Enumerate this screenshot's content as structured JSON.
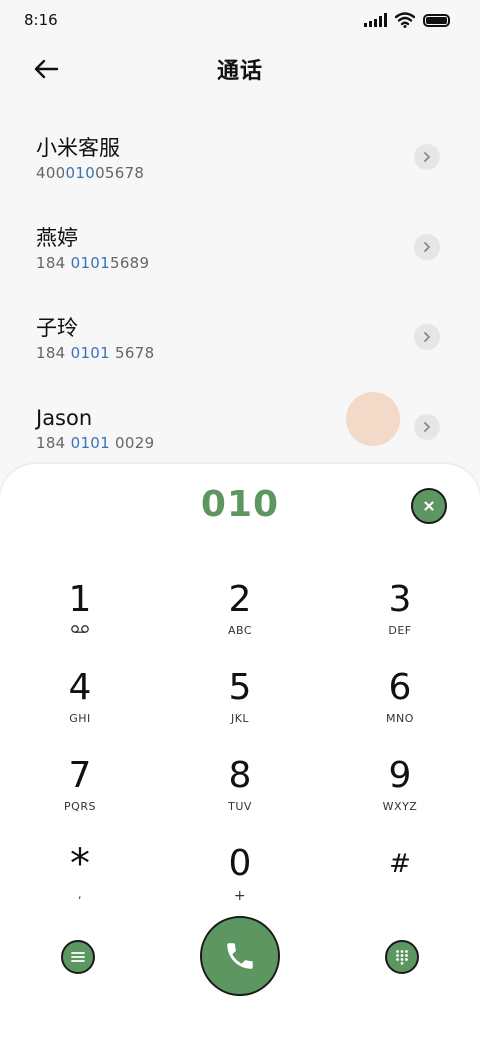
{
  "status_bar": {
    "time": "8:16"
  },
  "header": {
    "title": "通话"
  },
  "contacts": [
    {
      "name": "小米客服",
      "number_parts": [
        "400",
        "010",
        "05678"
      ]
    },
    {
      "name": "燕婷",
      "number_parts": [
        "184 ",
        "0101",
        "5689"
      ]
    },
    {
      "name": "子玲",
      "number_parts": [
        "184 ",
        "0101",
        " 5678"
      ]
    },
    {
      "name": "Jason",
      "number_parts": [
        "184 ",
        "0101",
        " 0029"
      ]
    }
  ],
  "dialpad": {
    "display": "010",
    "keys": [
      {
        "digit": "1",
        "letters": ""
      },
      {
        "digit": "2",
        "letters": "ABC"
      },
      {
        "digit": "3",
        "letters": "DEF"
      },
      {
        "digit": "4",
        "letters": "GHI"
      },
      {
        "digit": "5",
        "letters": "JKL"
      },
      {
        "digit": "6",
        "letters": "MNO"
      },
      {
        "digit": "7",
        "letters": "PQRS"
      },
      {
        "digit": "8",
        "letters": "TUV"
      },
      {
        "digit": "9",
        "letters": "WXYZ"
      },
      {
        "digit": "*",
        "letters": ","
      },
      {
        "digit": "0",
        "letters": "+"
      },
      {
        "digit": "#",
        "letters": ""
      }
    ]
  },
  "colors": {
    "accent_green": "#5d9660",
    "highlight_blue": "#3a72b8",
    "background": "#f7f7f7"
  },
  "icons": {
    "back": "arrow-left-icon",
    "chevron": "chevron-right-icon",
    "clear": "close-icon",
    "menu": "menu-icon",
    "call": "phone-icon",
    "keypad": "dialpad-icon",
    "voicemail": "voicemail-icon"
  }
}
